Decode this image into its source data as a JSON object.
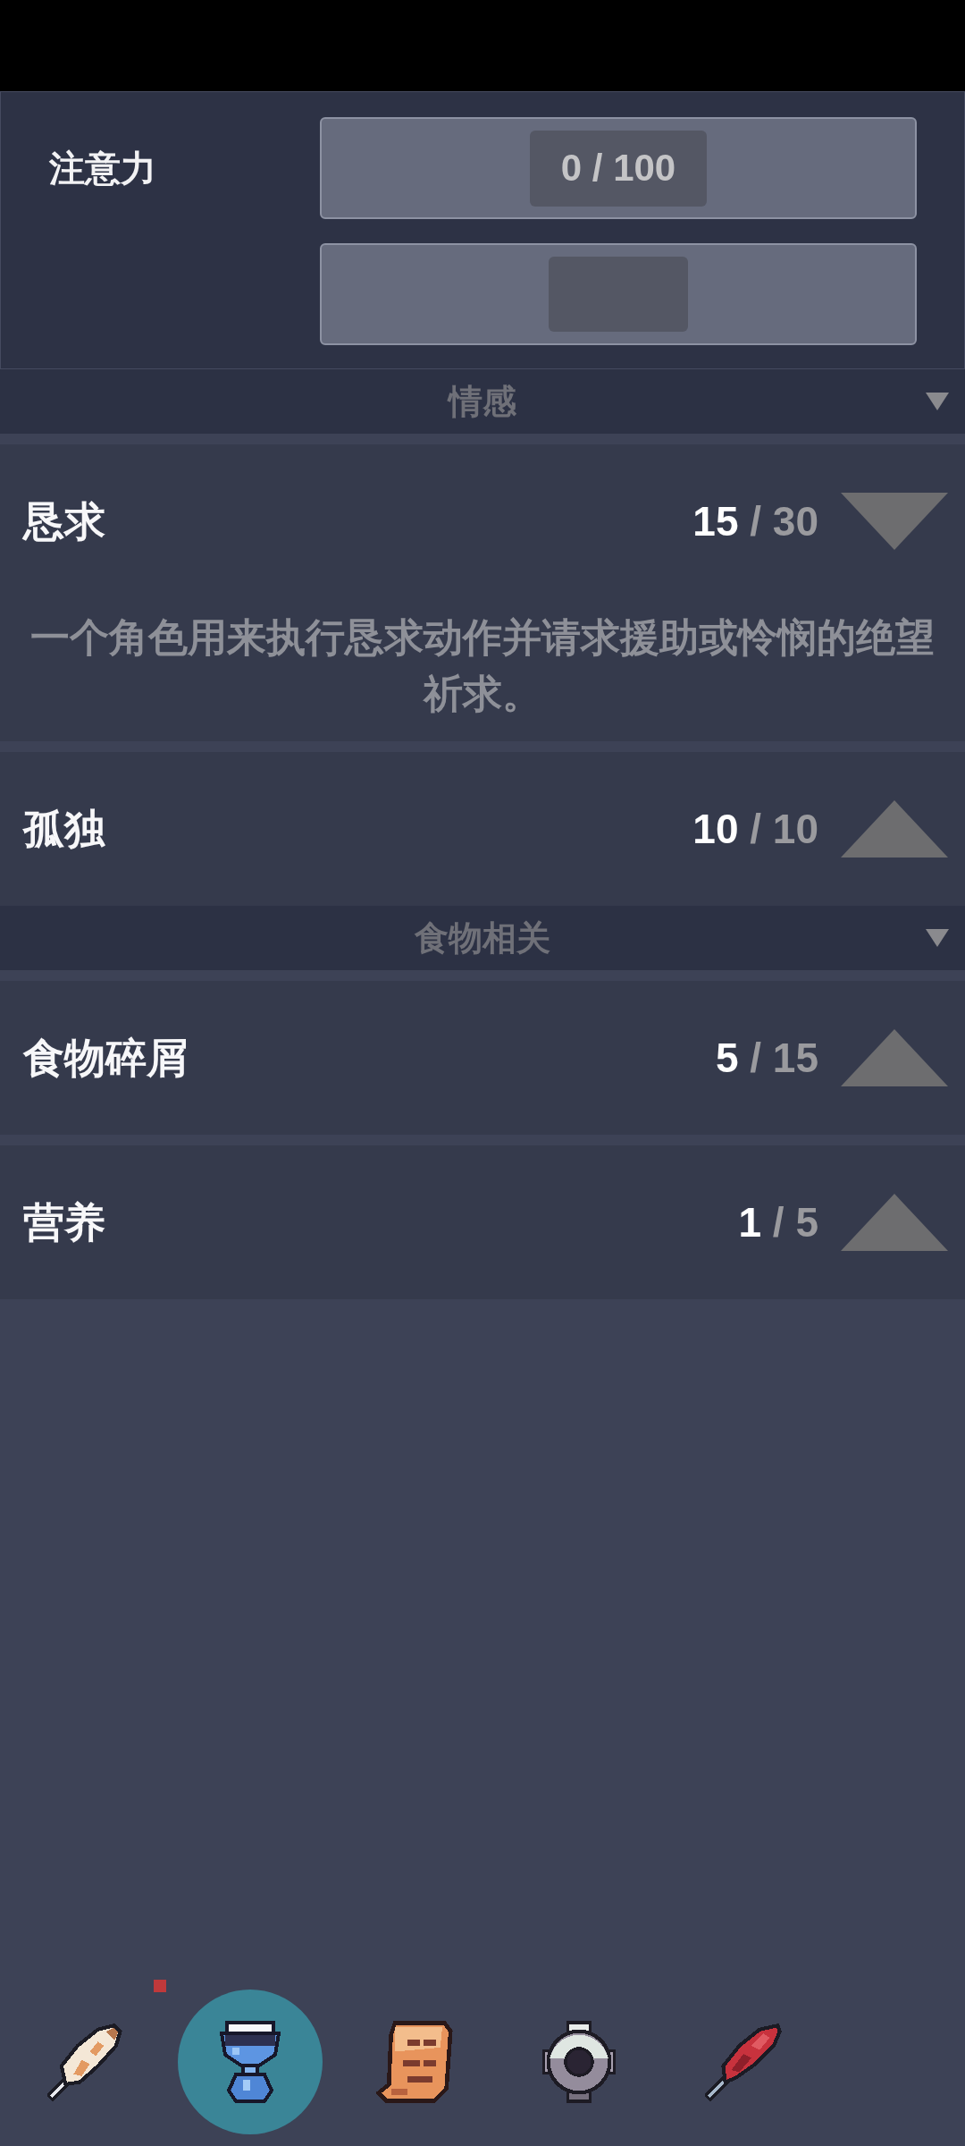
{
  "attention": {
    "label": "注意力",
    "bars": [
      {
        "kind": "counter",
        "reading": "0 / 100"
      },
      {
        "kind": "blank"
      }
    ]
  },
  "sections": [
    {
      "title": "情感",
      "expanded": true,
      "items": [
        {
          "name": "恳求",
          "count": "**15** / 30",
          "expanded": true,
          "description": "一个角色用来执行恳求动作并请求援助或怜悯的绝望祈求。"
        },
        {
          "name": "孤独",
          "count": "**10** / 10",
          "expanded": false
        }
      ]
    },
    {
      "title": "食物相关",
      "expanded": true,
      "items": [
        {
          "name": "食物碎屑",
          "count": "**5** / 15",
          "expanded": false
        },
        {
          "name": "营养",
          "count": "**1** / 5",
          "expanded": false
        }
      ]
    }
  ],
  "nav_tabs": [
    {
      "selected": false,
      "badge": true
    },
    {
      "selected": true,
      "badge": false
    },
    {
      "selected": false,
      "badge": false
    },
    {
      "selected": false,
      "badge": false
    },
    {
      "selected": false,
      "badge": false
    }
  ]
}
